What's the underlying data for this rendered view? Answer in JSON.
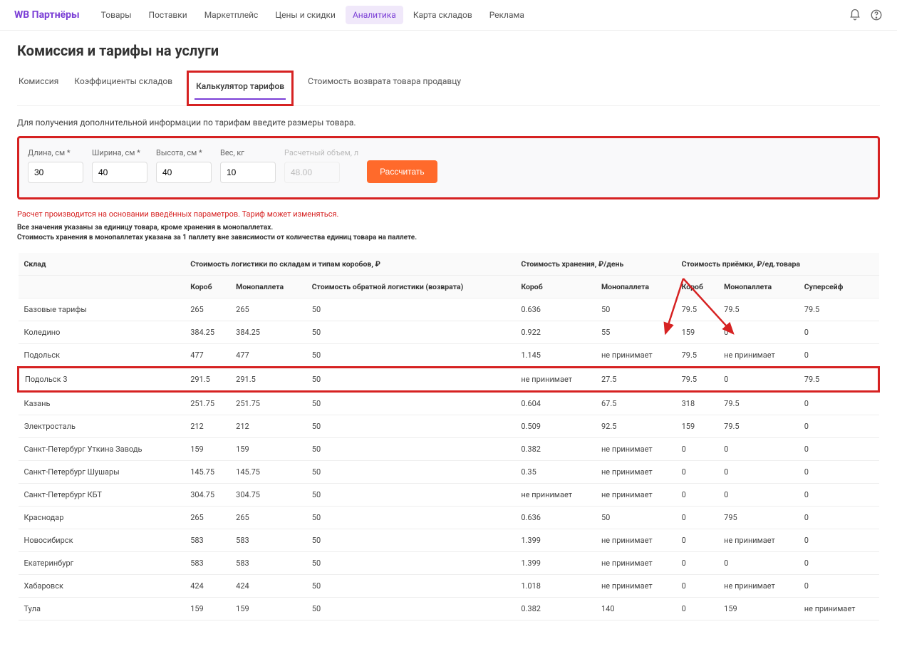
{
  "logo": "WB Партнёры",
  "nav": [
    "Товары",
    "Поставки",
    "Маркетплейс",
    "Цены и скидки",
    "Аналитика",
    "Карта складов",
    "Реклама"
  ],
  "nav_active": 4,
  "page_title": "Комиссия и тарифы на услуги",
  "tabs": [
    "Комиссия",
    "Коэффициенты складов",
    "Калькулятор тарифов",
    "Стоимость возврата товара продавцу"
  ],
  "tab_active": 2,
  "hint": "Для получения дополнительной информации по тарифам введите размеры товара.",
  "fields": {
    "length": {
      "label": "Длина, см *",
      "value": "30"
    },
    "width": {
      "label": "Ширина, см *",
      "value": "40"
    },
    "height": {
      "label": "Высота, см *",
      "value": "40"
    },
    "weight": {
      "label": "Вес, кг",
      "value": "10"
    },
    "volume": {
      "label": "Расчетный объем, л",
      "value": "48.00"
    }
  },
  "calc_btn": "Рассчитать",
  "warn": "Расчет производится на основании введённых параметров. Тариф может изменяться.",
  "note1": "Все значения указаны за единицу товара, кроме хранения в монопаллетах.",
  "note2": "Стоимость хранения в монопаллетах указана за 1 паллету вне зависимости от количества единиц товара на паллете.",
  "thead_group": [
    "Склад",
    "Стоимость логистики по складам и типам коробов, ₽",
    "Стоимость хранения, ₽/день",
    "Стоимость приёмки, ₽/ед.товара"
  ],
  "thead_sub": [
    "",
    "Короб",
    "Монопаллета",
    "Стоимость обратной логистики (возврата)",
    "Короб",
    "Монопаллета",
    "Короб",
    "Монопаллета",
    "Суперсейф"
  ],
  "rows": [
    {
      "c": [
        "Базовые тарифы",
        "265",
        "265",
        "50",
        "0.636",
        "50",
        "79.5",
        "79.5",
        "79.5"
      ]
    },
    {
      "c": [
        "Коледино",
        "384.25",
        "384.25",
        "50",
        "0.922",
        "55",
        "159",
        "0",
        "0"
      ]
    },
    {
      "c": [
        "Подольск",
        "477",
        "477",
        "50",
        "1.145",
        "не принимает",
        "79.5",
        "не принимает",
        "0"
      ]
    },
    {
      "c": [
        "Подольск 3",
        "291.5",
        "291.5",
        "50",
        "не принимает",
        "27.5",
        "79.5",
        "0",
        "79.5"
      ],
      "hl": true
    },
    {
      "c": [
        "Казань",
        "251.75",
        "251.75",
        "50",
        "0.604",
        "67.5",
        "318",
        "79.5",
        "0"
      ]
    },
    {
      "c": [
        "Электросталь",
        "212",
        "212",
        "50",
        "0.509",
        "92.5",
        "159",
        "79.5",
        "0"
      ]
    },
    {
      "c": [
        "Санкт-Петербург Уткина Заводь",
        "159",
        "159",
        "50",
        "0.382",
        "не принимает",
        "0",
        "0",
        "0"
      ]
    },
    {
      "c": [
        "Санкт-Петербург Шушары",
        "145.75",
        "145.75",
        "50",
        "0.35",
        "не принимает",
        "0",
        "0",
        "0"
      ]
    },
    {
      "c": [
        "Санкт-Петербург КБТ",
        "304.75",
        "304.75",
        "50",
        "не принимает",
        "не принимает",
        "0",
        "0",
        "0"
      ]
    },
    {
      "c": [
        "Краснодар",
        "265",
        "265",
        "50",
        "0.636",
        "50",
        "0",
        "795",
        "0"
      ]
    },
    {
      "c": [
        "Новосибирск",
        "583",
        "583",
        "50",
        "1.399",
        "не принимает",
        "0",
        "не принимает",
        "0"
      ]
    },
    {
      "c": [
        "Екатеринбург",
        "583",
        "583",
        "50",
        "1.399",
        "не принимает",
        "0",
        "0",
        "0"
      ]
    },
    {
      "c": [
        "Хабаровск",
        "424",
        "424",
        "50",
        "1.018",
        "не принимает",
        "0",
        "не принимает",
        "0"
      ]
    },
    {
      "c": [
        "Тула",
        "159",
        "159",
        "50",
        "0.382",
        "140",
        "0",
        "159",
        "не принимает"
      ]
    }
  ]
}
